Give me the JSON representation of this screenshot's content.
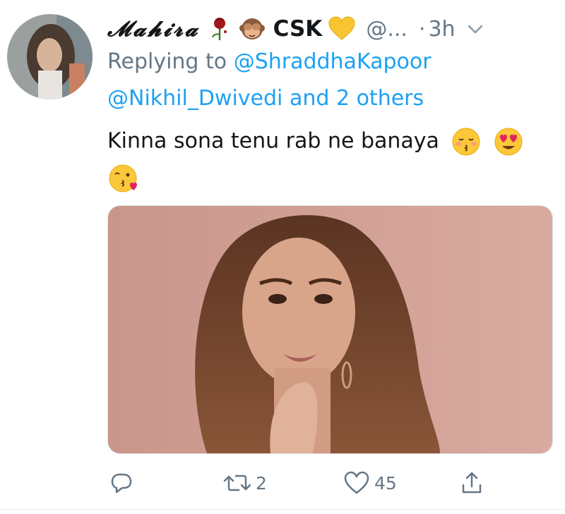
{
  "tweet": {
    "display_name": "𝓜𝓪𝓱𝓲𝓻𝓪",
    "team_label": "CSK",
    "handle": "@...",
    "separator": "·",
    "time": "3h",
    "reply": {
      "prefix": "Replying to",
      "mention1": "@ShraddhaKapoor",
      "mention2": "@Nikhil_Dwivedi",
      "connector": "and",
      "others": "2 others"
    },
    "text": "Kinna sona tenu rab ne banaya",
    "emojis": [
      "wilted-rose-icon",
      "see-no-evil-monkey-icon",
      "yellow-heart-icon",
      "kissing-closed-eyes-icon",
      "heart-eyes-icon",
      "face-blowing-kiss-icon"
    ]
  },
  "actions": {
    "reply_count": "",
    "retweet_count": "2",
    "like_count": "45"
  },
  "colors": {
    "text": "#14171a",
    "secondary": "#657786",
    "link": "#1da1f2"
  }
}
